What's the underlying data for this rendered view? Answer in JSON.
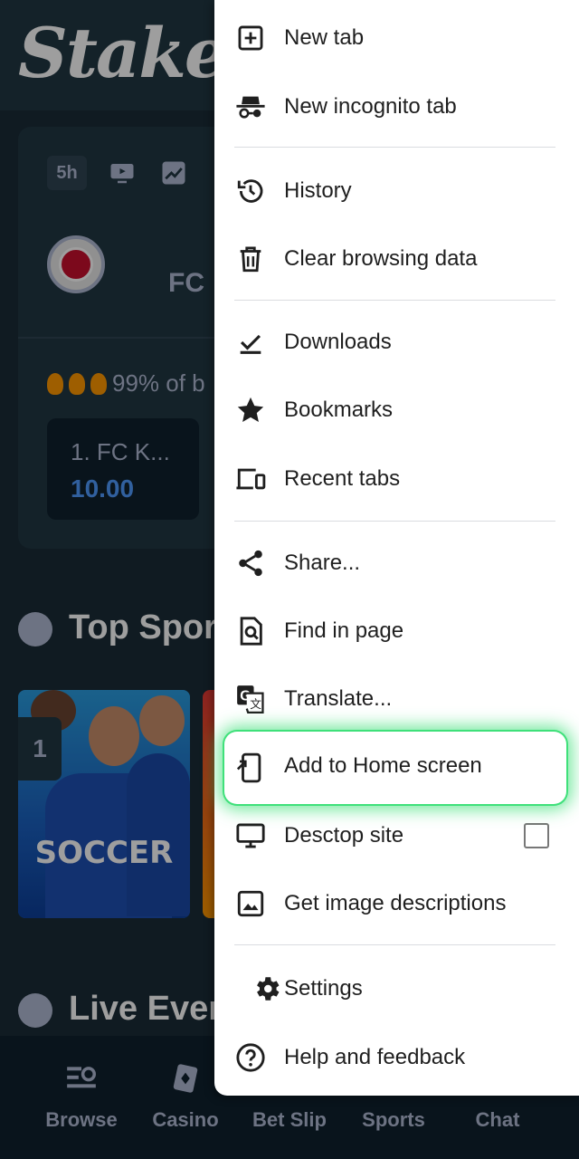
{
  "app": {
    "logo": "Stake",
    "match": {
      "time_chip": "5h",
      "team": "FC",
      "popularity": "99% of b",
      "odds_team": "1. FC K...",
      "odds_value": "10.00"
    },
    "sections": {
      "top_sports": "Top Spor",
      "live_events": "Live Even"
    },
    "promo": {
      "rank": "1",
      "label": "SOCCER"
    },
    "bottom_nav": [
      {
        "label": "Browse",
        "icon": "browse-icon"
      },
      {
        "label": "Casino",
        "icon": "cards-icon"
      },
      {
        "label": "Bet Slip",
        "icon": "betslip-icon"
      },
      {
        "label": "Sports",
        "icon": "ball-icon"
      },
      {
        "label": "Chat",
        "icon": "chat-icon"
      }
    ]
  },
  "menu": {
    "items": [
      {
        "label": "New tab",
        "icon": "plus-box-icon"
      },
      {
        "label": "New incognito tab",
        "icon": "incognito-icon"
      },
      {
        "label": "History",
        "icon": "history-icon"
      },
      {
        "label": "Clear browsing data",
        "icon": "trash-icon"
      },
      {
        "label": "Downloads",
        "icon": "download-icon"
      },
      {
        "label": "Bookmarks",
        "icon": "star-icon"
      },
      {
        "label": "Recent tabs",
        "icon": "devices-icon"
      },
      {
        "label": "Share...",
        "icon": "share-icon"
      },
      {
        "label": "Find in page",
        "icon": "find-in-page-icon"
      },
      {
        "label": "Translate...",
        "icon": "translate-icon"
      },
      {
        "label": "Add to Home screen",
        "icon": "add-to-home-icon"
      },
      {
        "label": "Desctop site",
        "icon": "monitor-icon",
        "checked": false
      },
      {
        "label": "Get image descriptions",
        "icon": "image-icon"
      },
      {
        "label": "Settings",
        "icon": "gear-icon"
      },
      {
        "label": "Help and feedback",
        "icon": "help-icon"
      }
    ],
    "highlighted_item": "Add to Home screen"
  }
}
